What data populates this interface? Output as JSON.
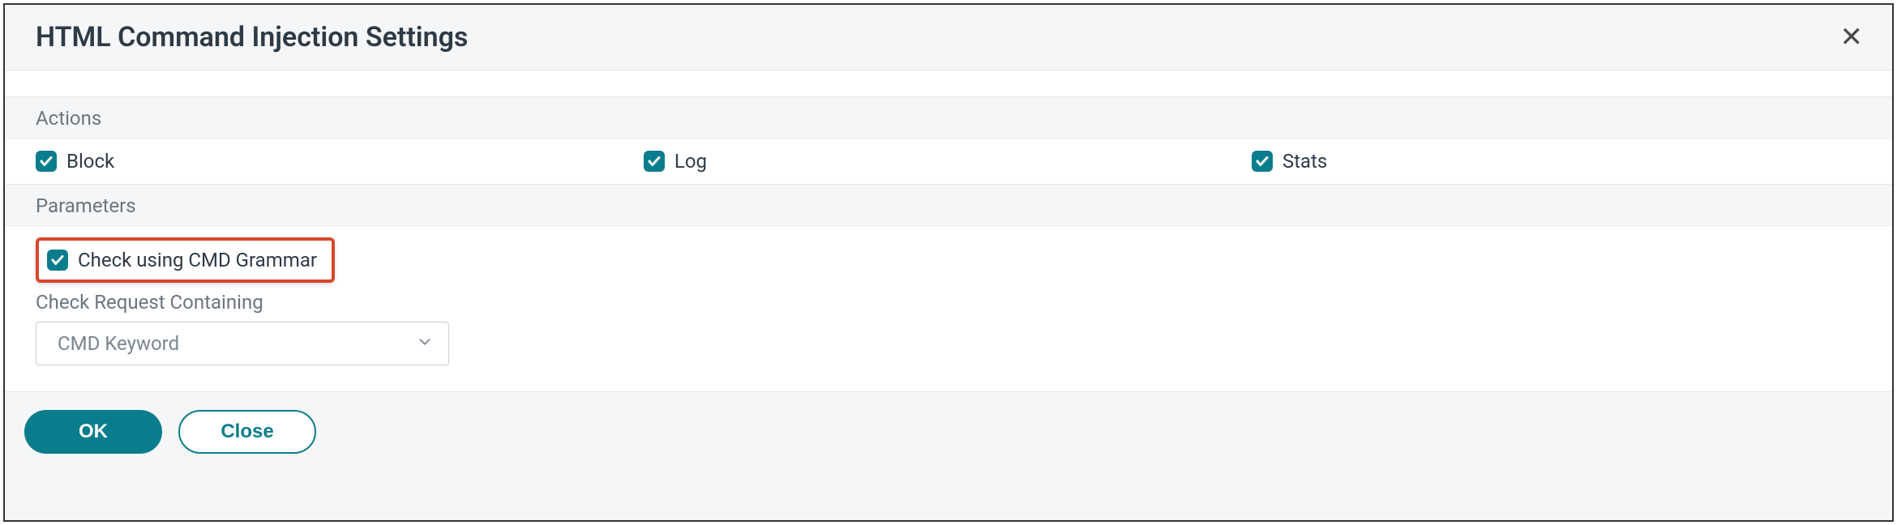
{
  "header": {
    "title": "HTML Command Injection Settings"
  },
  "sections": {
    "actions_label": "Actions",
    "parameters_label": "Parameters"
  },
  "actions": {
    "block": {
      "label": "Block",
      "checked": true
    },
    "log": {
      "label": "Log",
      "checked": true
    },
    "stats": {
      "label": "Stats",
      "checked": true
    }
  },
  "parameters": {
    "cmd_grammar": {
      "label": "Check using CMD Grammar",
      "checked": true,
      "highlighted": true
    },
    "request_containing_label": "Check Request Containing",
    "request_containing_value": "CMD Keyword"
  },
  "footer": {
    "ok_label": "OK",
    "close_label": "Close"
  },
  "colors": {
    "accent": "#0a7d8c",
    "highlight_border": "#d9472b",
    "text_primary": "#2f3a46",
    "text_secondary": "#6b7580"
  }
}
